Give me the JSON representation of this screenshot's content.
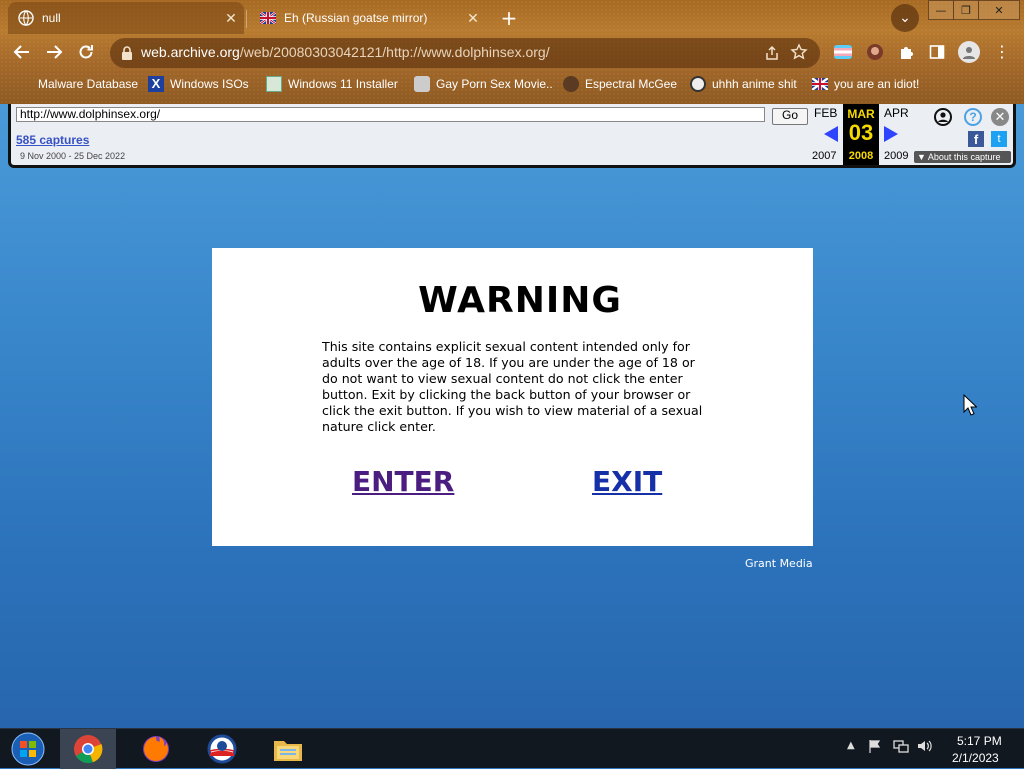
{
  "browser": {
    "tabs": [
      {
        "title": "null",
        "icon": "globe-icon",
        "active": true
      },
      {
        "title": "Eh (Russian goatse mirror)",
        "icon": "uk-flag-icon",
        "active": false
      }
    ],
    "new_tab": "+",
    "close_glyph": "✕",
    "tab_search_glyph": "⌄",
    "window_buttons": {
      "minimize": "—",
      "maximize": "❐",
      "close": "✕"
    },
    "url": {
      "host": "web.archive.org",
      "path": "/web/20080303042121/http://www.dolphinsex.org/"
    },
    "bookmarks": [
      {
        "label": "Malware Database",
        "icon": "none"
      },
      {
        "label": "Windows ISOs",
        "icon": "x-icon"
      },
      {
        "label": "Windows 11 Installer",
        "icon": "installer-icon"
      },
      {
        "label": "Gay Porn Sex Movie..",
        "icon": "sticker-icon"
      },
      {
        "label": "Espectral McGee",
        "icon": "avatar-icon"
      },
      {
        "label": "uhhh anime shit",
        "icon": "anime-icon"
      },
      {
        "label": "you are an idiot!",
        "icon": "uk-flag-icon"
      }
    ]
  },
  "wayback": {
    "url_value": "http://www.dolphinsex.org/",
    "go_label": "Go",
    "captures": "585 captures",
    "range": "9 Nov 2000 - 25 Dec 2022",
    "prev_month": "FEB",
    "prev_year": "2007",
    "current_month": "MAR",
    "current_day": "03",
    "current_year": "2008",
    "next_month": "APR",
    "next_year": "2009",
    "help_glyph": "?",
    "close_glyph": "✕",
    "fb_glyph": "f",
    "tw_glyph": "t",
    "about": "▼ About this capture"
  },
  "page": {
    "title": "WARNING",
    "body": "This site contains explicit sexual content intended only for adults over the age of 18. If you are under the age of 18 or do not want to view sexual content do not click the enter button. Exit by clicking the back button of your browser or click the exit button. If you wish to view material of a sexual nature click enter.",
    "enter_label": "ENTER",
    "exit_label": "EXIT",
    "footer": "Grant Media",
    "colors": {
      "enter_link": "#4b1d80",
      "exit_link": "#1631a8",
      "background": "#2f76c0"
    }
  },
  "taskbar": {
    "apps": [
      "start-orb",
      "chrome",
      "firefox",
      "ie",
      "explorer"
    ],
    "time": "5:17 PM",
    "date": "2/1/2023"
  }
}
